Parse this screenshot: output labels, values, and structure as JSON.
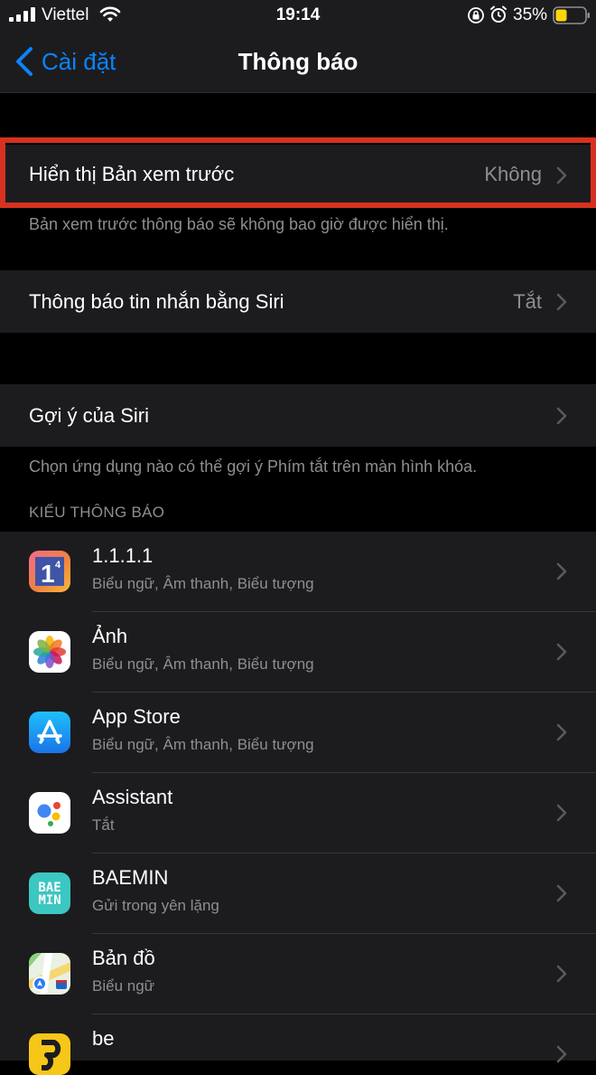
{
  "status_bar": {
    "carrier": "Viettel",
    "time": "19:14",
    "battery_percent": "35%"
  },
  "nav": {
    "back_label": "Cài đặt",
    "title": "Thông báo"
  },
  "settings": {
    "show_previews": {
      "label": "Hiển thị Bản xem trước",
      "value": "Không",
      "footer": "Bản xem trước thông báo sẽ không bao giờ được hiển thị."
    },
    "announce_messages": {
      "label": "Thông báo tin nhắn bằng Siri",
      "value": "Tắt"
    },
    "siri_suggestions": {
      "label": "Gợi ý của Siri",
      "footer": "Chọn ứng dụng nào có thể gợi ý Phím tắt trên màn hình khóa."
    }
  },
  "notification_style": {
    "header": "KIỂU THÔNG BÁO",
    "apps": [
      {
        "name": "1.1.1.1",
        "detail": "Biểu ngữ, Âm thanh, Biểu tượng",
        "icon": "cloudflare-1111-icon"
      },
      {
        "name": "Ảnh",
        "detail": "Biểu ngữ, Âm thanh, Biểu tượng",
        "icon": "photos-icon"
      },
      {
        "name": "App Store",
        "detail": "Biểu ngữ, Âm thanh, Biểu tượng",
        "icon": "app-store-icon"
      },
      {
        "name": "Assistant",
        "detail": "Tắt",
        "icon": "google-assistant-icon"
      },
      {
        "name": "BAEMIN",
        "detail": "Gửi trong yên lặng",
        "icon": "baemin-icon",
        "icon_text": "BAE\nMIN"
      },
      {
        "name": "Bản đồ",
        "detail": "Biểu ngữ",
        "icon": "maps-icon"
      },
      {
        "name": "be",
        "detail": "",
        "icon": "be-icon"
      }
    ]
  },
  "colors": {
    "accent": "#0a84ff",
    "highlight_border": "#d6321f",
    "cell_bg": "#1c1c1e",
    "secondary_text": "#8e8e93"
  }
}
